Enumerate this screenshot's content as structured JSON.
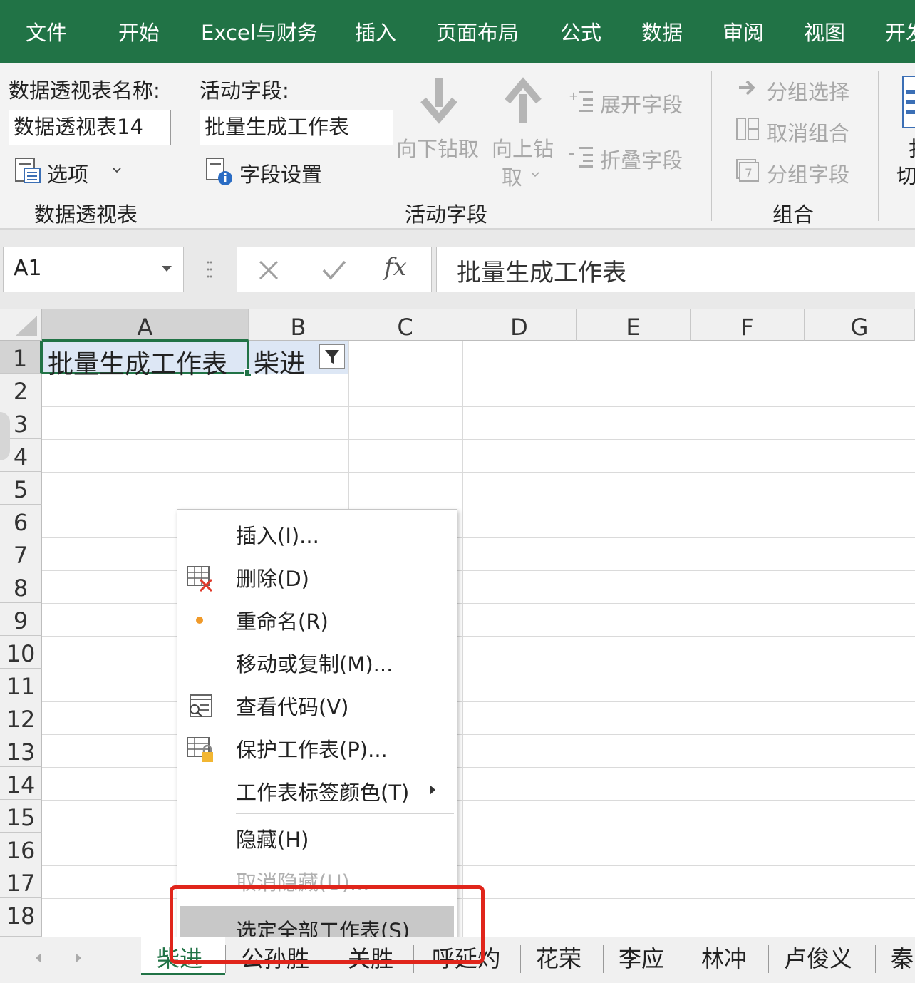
{
  "ribbon_tabs": [
    "文件",
    "开始",
    "Excel与财务",
    "插入",
    "页面布局",
    "公式",
    "数据",
    "审阅",
    "视图",
    "开发"
  ],
  "pivot_group": {
    "name_label": "数据透视表名称:",
    "name_value": "数据透视表14",
    "options_label": "选项",
    "group_label": "数据透视表"
  },
  "active_field_group": {
    "label": "活动字段:",
    "value": "批量生成工作表",
    "field_settings": "字段设置",
    "drill_down": "向下钻取",
    "drill_up_line1": "向上钻",
    "drill_up_line2": "取",
    "expand_field": "展开字段",
    "collapse_field": "折叠字段",
    "group_label": "活动字段"
  },
  "group_group": {
    "group_selection": "分组选择",
    "ungroup": "取消组合",
    "group_field": "分组字段",
    "group_label": "组合"
  },
  "partial_right": {
    "line1": "扌",
    "line2": "切"
  },
  "formula_bar": {
    "name_box": "A1",
    "fx": "fx",
    "content": "批量生成工作表"
  },
  "columns": [
    "A",
    "B",
    "C",
    "D",
    "E",
    "F",
    "G"
  ],
  "rows": [
    "1",
    "2",
    "3",
    "4",
    "5",
    "6",
    "7",
    "8",
    "9",
    "10",
    "11",
    "12",
    "13",
    "14",
    "15",
    "16",
    "17",
    "18"
  ],
  "cells": {
    "A1": "批量生成工作表",
    "B1": "柴进"
  },
  "context_menu": [
    {
      "label": "插入(I)...",
      "icon": "none",
      "disabled": false
    },
    {
      "label": "删除(D)",
      "icon": "delete-sheet-icon",
      "disabled": false
    },
    {
      "label": "重命名(R)",
      "icon": "dot-icon",
      "disabled": false
    },
    {
      "label": "移动或复制(M)...",
      "icon": "none",
      "disabled": false
    },
    {
      "label": "查看代码(V)",
      "icon": "view-code-icon",
      "disabled": false
    },
    {
      "label": "保护工作表(P)...",
      "icon": "protect-sheet-icon",
      "disabled": false
    },
    {
      "label": "工作表标签颜色(T)",
      "icon": "submenu-arrow-icon",
      "disabled": false
    },
    {
      "label": "隐藏(H)",
      "icon": "none",
      "disabled": false
    },
    {
      "label": "取消隐藏(U)...",
      "icon": "none",
      "disabled": true
    },
    {
      "label": "选定全部工作表(S)",
      "icon": "none",
      "disabled": false
    }
  ],
  "sheet_tabs": [
    "柴进",
    "公孙胜",
    "关胜",
    "呼延灼",
    "花荣",
    "李应",
    "林冲",
    "卢俊义",
    "秦"
  ],
  "colors": {
    "excel_green": "#217346",
    "highlight_red": "#e0251b",
    "menu_selected": "#c8c8c8"
  }
}
